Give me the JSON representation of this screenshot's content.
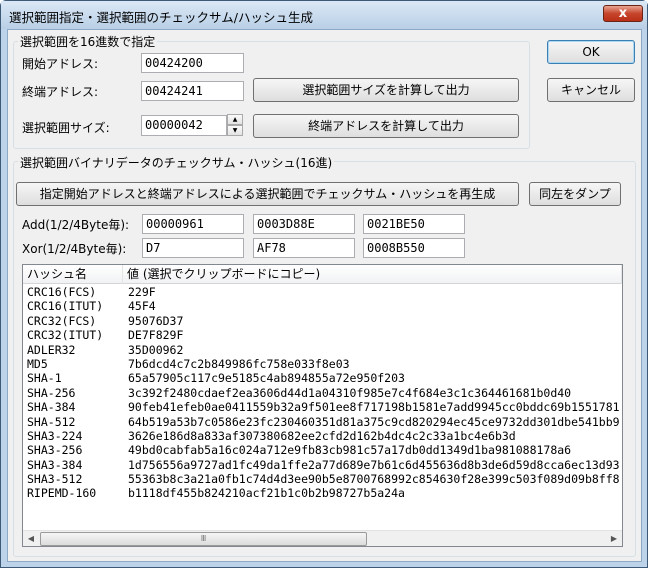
{
  "window": {
    "title": "選択範囲指定・選択範囲のチェックサム/ハッシュ生成",
    "close_glyph": "x"
  },
  "range_group": {
    "label": "選択範囲を16進数で指定",
    "start_label": "開始アドレス:",
    "start_value": "00424200",
    "end_label": "終端アドレス:",
    "end_value": "00424241",
    "size_label": "選択範囲サイズ:",
    "size_value": "00000042",
    "calc_size_button": "選択範囲サイズを計算して出力",
    "calc_end_button": "終端アドレスを計算して出力"
  },
  "dialog_buttons": {
    "ok": "OK",
    "cancel": "キャンセル"
  },
  "checksum_group": {
    "label": "選択範囲バイナリデータのチェックサム・ハッシュ(16進)",
    "regenerate_button": "指定開始アドレスと終端アドレスによる選択範囲でチェックサム・ハッシュを再生成",
    "dump_button": "同左をダンプ",
    "add_label": "Add(1/2/4Byte毎):",
    "add_values": [
      "00000961",
      "0003D88E",
      "0021BE50"
    ],
    "xor_label": "Xor(1/2/4Byte毎):",
    "xor_values": [
      "D7",
      "AF78",
      "0008B550"
    ]
  },
  "hash_table": {
    "columns": [
      "ハッシュ名",
      "値 (選択でクリップボードにコピー)"
    ],
    "rows": [
      {
        "name": "CRC16(FCS)",
        "value": "229F"
      },
      {
        "name": "CRC16(ITUT)",
        "value": "45F4"
      },
      {
        "name": "CRC32(FCS)",
        "value": "95076D37"
      },
      {
        "name": "CRC32(ITUT)",
        "value": "DE7F829F"
      },
      {
        "name": "ADLER32",
        "value": "35D00962"
      },
      {
        "name": "MD5",
        "value": "7b6dcd4c7c2b849986fc758e033f8e03"
      },
      {
        "name": "SHA-1",
        "value": "65a57905c117c9e5185c4ab894855a72e950f203"
      },
      {
        "name": "SHA-256",
        "value": "3c392f2480cdaef2ea3606d44d1a04310f985e7c4f684e3c1c364461681b0d40"
      },
      {
        "name": "SHA-384",
        "value": "90feb41efeb0ae0411559b32a9f501ee8f717198b1581e7add9945cc0bddc69b1551781"
      },
      {
        "name": "SHA-512",
        "value": "64b519a53b7c0586e23fc230460351d81a375c9cd820294ec45ce9732dd301dbe541bb9"
      },
      {
        "name": "SHA3-224",
        "value": "3626e186d8a833af307380682ee2cfd2d162b4dc4c2c33a1bc4e6b3d"
      },
      {
        "name": "SHA3-256",
        "value": "49bd0cabfab5a16c024a712e9fb83cb981c57a17db0dd1349d1ba981088178a6"
      },
      {
        "name": "SHA3-384",
        "value": "1d756556a9727ad1fc49da1ffe2a77d689e7b61c6d455636d8b3de6d59d8cca6ec13d93"
      },
      {
        "name": "SHA3-512",
        "value": "55363b8c3a21a0fb1c74d4d3ee90b5e8700768992c854630f28e399c503f089d09b8ff8"
      },
      {
        "name": "RIPEMD-160",
        "value": "b1118df455b824210acf21b1c0b2b98727b5a24a"
      }
    ],
    "scroll_thumb_glyph": "Ⅲ"
  }
}
